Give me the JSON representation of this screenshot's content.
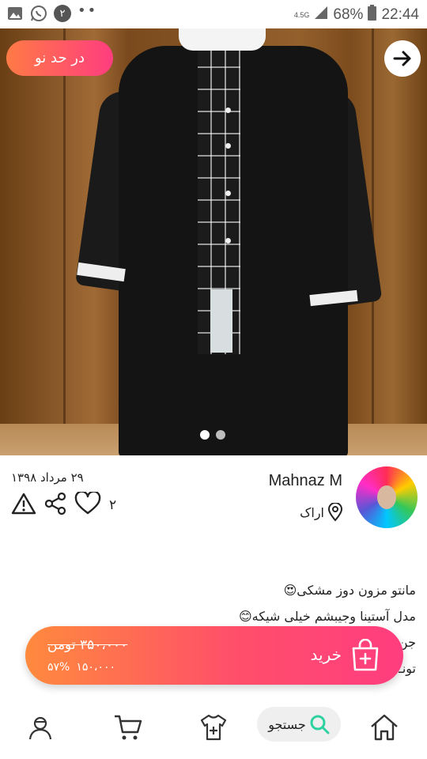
{
  "status_bar": {
    "notification_badge": "۲",
    "network": "4.5G",
    "battery": "68%",
    "time": "22:44"
  },
  "listing": {
    "badge_label": "در حد نو",
    "image_count": 2,
    "active_image_index": 0
  },
  "seller": {
    "name": "Mahnaz M",
    "city": "اراک"
  },
  "post": {
    "date": "۲۹ مرداد ۱۳۹۸",
    "like_count": "۲"
  },
  "description": {
    "lines": [
      "مانتو مزون دوز مشکی😍",
      "مدل آستینا وجیبشم خیلی شیکه😊",
      "جن",
      "تونـ"
    ]
  },
  "buy_bar": {
    "label": "خرید",
    "old_price": "۳۵۰،۰۰۰ تومن",
    "new_price": "۱۵۰،۰۰۰",
    "discount": "۵۷%"
  },
  "nav": {
    "search_label": "جستجو",
    "items": [
      "home-icon",
      "search-icon",
      "add-item-icon",
      "cart-icon",
      "profile-icon"
    ]
  },
  "colors": {
    "accent_start": "#ff8a3d",
    "accent_end": "#ff3d7f",
    "search_icon": "#2ed1a0"
  }
}
